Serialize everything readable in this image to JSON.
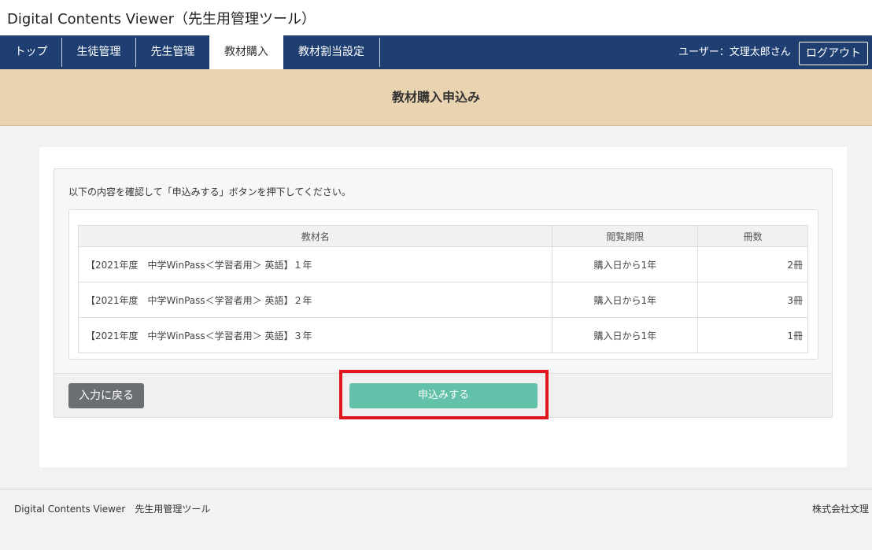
{
  "app": {
    "title": "Digital Contents Viewer（先生用管理ツール）"
  },
  "nav": {
    "items": [
      {
        "label": "トップ"
      },
      {
        "label": "生徒管理"
      },
      {
        "label": "先生管理"
      },
      {
        "label": "教材購入"
      },
      {
        "label": "教材割当設定"
      }
    ],
    "active": "教材購入",
    "user_label": "ユーザー：文理太郎さん",
    "logout_label": "ログアウト"
  },
  "page": {
    "heading": "教材購入申込み"
  },
  "content": {
    "instruction": "以下の内容を確認して「申込みする」ボタンを押下してください。",
    "table": {
      "headers": {
        "name": "教材名",
        "period": "閲覧期限",
        "quantity": "冊数"
      },
      "rows": [
        {
          "name": "【2021年度　中学WinPass＜学習者用＞ 英語】１年",
          "period": "購入日から1年",
          "quantity": "2冊"
        },
        {
          "name": "【2021年度　中学WinPass＜学習者用＞ 英語】２年",
          "period": "購入日から1年",
          "quantity": "3冊"
        },
        {
          "name": "【2021年度　中学WinPass＜学習者用＞ 英語】３年",
          "period": "購入日から1年",
          "quantity": "1冊"
        }
      ]
    },
    "back_label": "入力に戻る",
    "submit_label": "申込みする"
  },
  "footer": {
    "left": "Digital Contents Viewer　先生用管理ツール",
    "right": "株式会社文理"
  },
  "colors": {
    "navbar": "#1f3f72",
    "banner": "#ead3b0",
    "submit": "#63c1a9",
    "back": "#6b6e72",
    "highlight": "#e0151e"
  }
}
